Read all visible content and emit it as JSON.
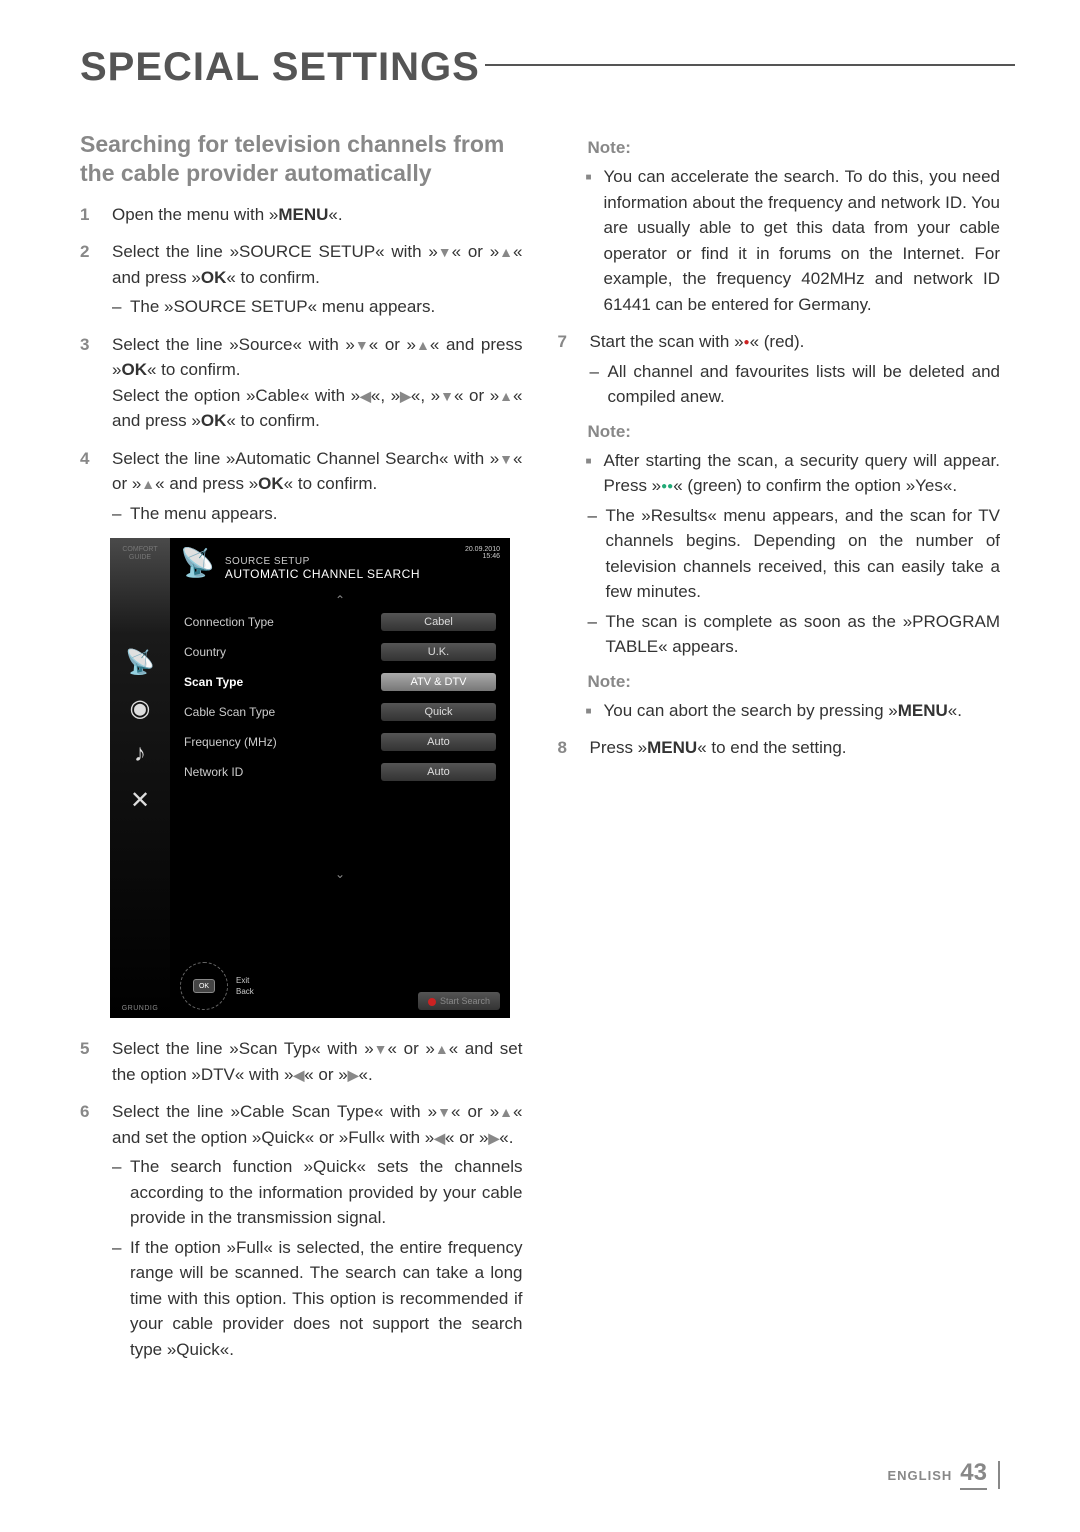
{
  "page_title": "SPECIAL SETTINGS",
  "section_heading": "Searching for television channels from the cable provider automatically",
  "steps": {
    "1": "Open the menu with »MENU«.",
    "2": {
      "main": "Select the line »SOURCE SETUP« with »▼« or »▲« and press »OK« to confirm.",
      "sub": "The »SOURCE SETUP« menu appears."
    },
    "3": {
      "main_a": "Select the line »Source« with »▼« or »▲« and press »OK« to confirm.",
      "main_b": "Select the option »Cable« with »◀«, »▶«, »▼« or »▲« and press »OK« to confirm."
    },
    "4": {
      "main": "Select the line »Automatic Channel Search« with »▼« or »▲« and press »OK« to confirm.",
      "sub": "The menu appears."
    },
    "5": "Select the line »Scan Typ« with »▼« or »▲« and set the option »DTV« with »◀« or »▶«.",
    "6": {
      "main": "Select the line »Cable Scan Type« with »▼« or »▲« and set the option »Quick« or »Full« with »◀« or »▶«.",
      "sub1": "The search function »Quick« sets the channels according to the information provided by your cable provide in the transmission signal.",
      "sub2": "If the option »Full« is selected, the entire frequency range will be scanned. The search can take a long time with this option. This option is recommended if your cable provider does not support the search type »Quick«."
    },
    "7": {
      "main": "Start the scan with »●« (red).",
      "sub": "All channel and favourites lists will be deleted and compiled anew."
    },
    "8": "Press »MENU« to end the setting."
  },
  "notes": {
    "1": {
      "heading": "Note:",
      "body": "You can accelerate the search. To do this, you need information about the frequency and network ID. You are usually able to get this data from your cable operator or find it in forums on the Internet. For example, the frequency 402MHz and network ID 61441 can be entered for Germany."
    },
    "2": {
      "heading": "Note:",
      "body": "After starting the scan, a security query will appear. Press »●●« (green) to confirm the option »Yes«.",
      "sub1": "The »Results« menu appears, and the scan for TV channels begins. Depending on the number of television channels received, this can easily take a few minutes.",
      "sub2": "The scan is complete as soon as the »PROGRAM TABLE« appears."
    },
    "3": {
      "heading": "Note:",
      "body": "You can abort the search by pressing »MENU«."
    }
  },
  "osd": {
    "comfort": "COMFORT GUIDE",
    "brand": "GRUNDIG",
    "title1": "SOURCE SETUP",
    "title2": "AUTOMATIC CHANNEL SEARCH",
    "date": "20.09.2010",
    "time": "15:46",
    "rows": {
      "connection_type": {
        "label": "Connection Type",
        "value": "Cabel"
      },
      "country": {
        "label": "Country",
        "value": "U.K."
      },
      "scan_type": {
        "label": "Scan Type",
        "value": "ATV & DTV"
      },
      "cable_scan_type": {
        "label": "Cable Scan Type",
        "value": "Quick"
      },
      "frequency": {
        "label": "Frequency (MHz)",
        "value": "Auto"
      },
      "network_id": {
        "label": "Network ID",
        "value": "Auto"
      }
    },
    "ok": "OK",
    "exit": "Exit",
    "back": "Back",
    "start_search": "Start Search"
  },
  "footer": {
    "lang": "ENGLISH",
    "page": "43"
  }
}
